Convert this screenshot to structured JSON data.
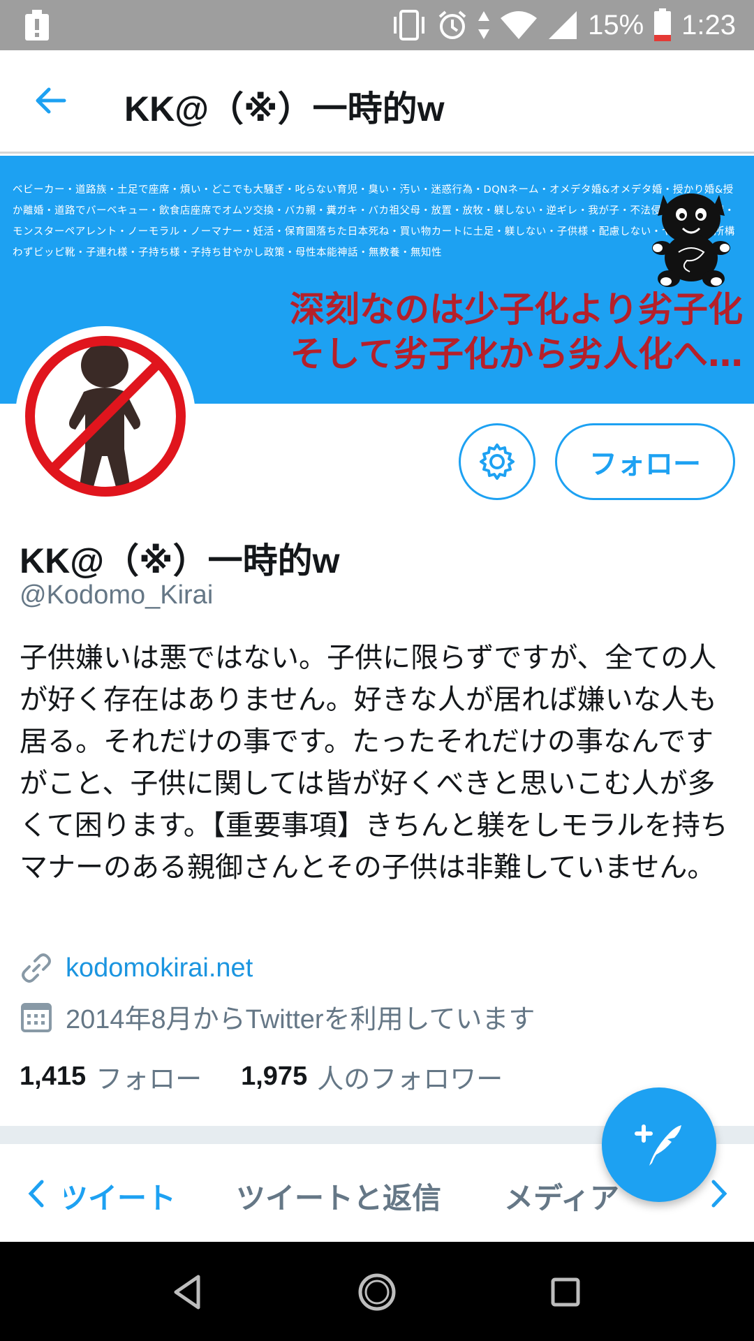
{
  "status_bar": {
    "battery": "15%",
    "time": "1:23",
    "icons": [
      "alert-icon",
      "vibrate-icon",
      "alarm-icon",
      "data-arrows-icon",
      "wifi-icon",
      "signal-icon",
      "battery-icon"
    ]
  },
  "header": {
    "title": "KK@（※）一時的w",
    "back_icon": "arrow-left-icon"
  },
  "banner": {
    "small_text": "ベビーカー・道路族・土足で座席・煩い・どこでも大騒ぎ・叱らない育児・臭い・汚い・迷惑行為・DQNネーム・オメデタ婚&オメデタ婚・授かり婚&授か離婚・道路でバーベキュー・飲食店座席でオムツ交換・バカ親・糞ガキ・バカ祖父母・放置・放牧・躾しない・逆ギレ・我が子・不法侵入・器物損壊・モンスターペアレント・ノーモラル・ノーマナー・妊活・保育園落ちた日本死ね・買い物カートに土足・躾しない・子供様・配慮しない・ヤンキー・所構わずビッピ靴・子連れ様・子持ち様・子持ち甘やかし政策・母性本能神話・無教養・無知性",
    "headline_line1": "深刻なのは少子化より劣子化",
    "headline_line2": "そして劣子化から劣人化へ…"
  },
  "profile": {
    "display_name": "KK@（※）一時的w",
    "handle": "@Kodomo_Kirai",
    "bio": "子供嫌いは悪ではない。子供に限らずですが、全ての人が好く存在はありません。好きな人が居れば嫌いな人も居る。それだけの事です。たったそれだけの事なんですがこと、子供に関しては皆が好くべきと思いこむ人が多くて困ります。【重要事項】きちんと躾をしモラルを持ちマナーのある親御さんとその子供は非難していません。",
    "website": "kodomokirai.net",
    "joined": "2014年8月からTwitterを利用しています",
    "following_count": "1,415",
    "following_label": "フォロー",
    "followers_count": "1,975",
    "followers_label": "人のフォロワー"
  },
  "actions": {
    "settings_icon": "gear-icon",
    "follow_label": "フォロー"
  },
  "tabs": {
    "items": [
      "ツイート",
      "ツイートと返信",
      "メディア"
    ],
    "active_index": 0
  },
  "fab": {
    "icon": "compose-tweet-icon"
  },
  "nav_bar": {
    "icons": [
      "nav-back-icon",
      "nav-home-icon",
      "nav-recents-icon"
    ]
  },
  "colors": {
    "accent": "#1da1f2",
    "status_bar": "#9e9e9e",
    "headline_red": "#b5202a",
    "secondary_text": "#657786",
    "divider": "#e6ecf0"
  }
}
